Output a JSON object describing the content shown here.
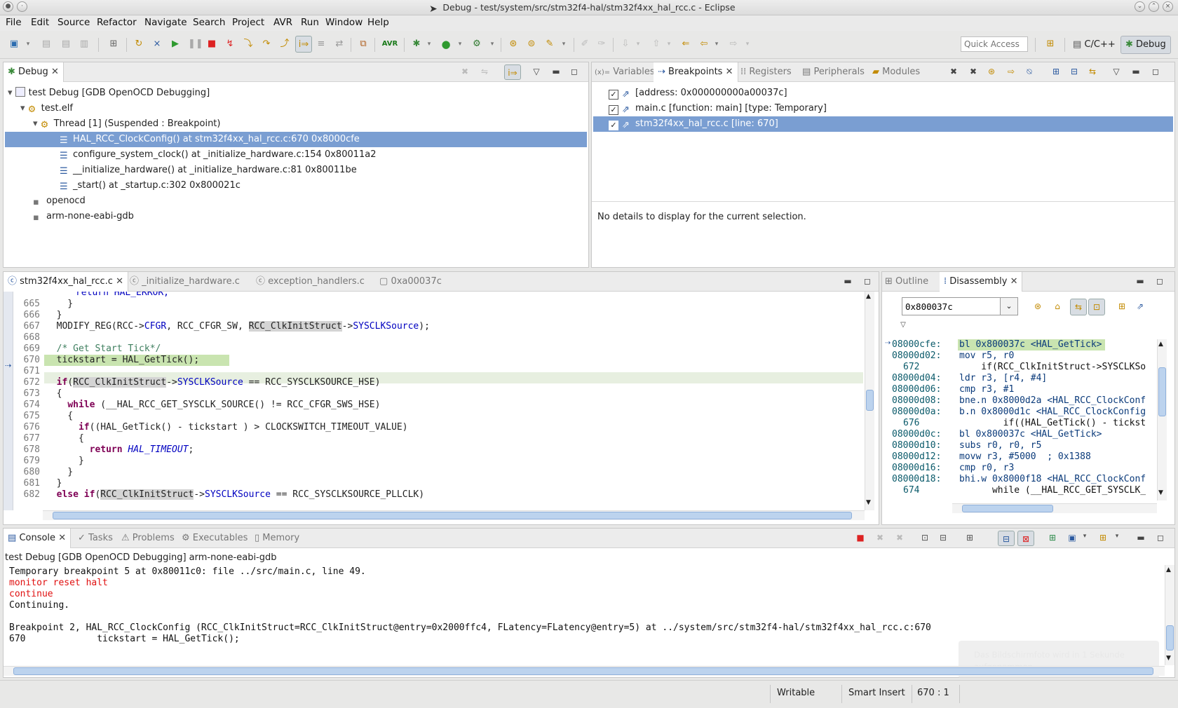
{
  "window": {
    "title": "Debug - test/system/src/stm32f4-hal/stm32f4xx_hal_rcc.c - Eclipse"
  },
  "menu": [
    "File",
    "Edit",
    "Source",
    "Refactor",
    "Navigate",
    "Search",
    "Project",
    "AVR",
    "Run",
    "Window",
    "Help"
  ],
  "toolbar": {
    "quick_access_placeholder": "Quick Access",
    "perspective_cpp": "C/C++",
    "perspective_debug": "Debug",
    "avr_label": "AVR"
  },
  "debug_view": {
    "tab": "Debug",
    "launch": "test Debug [GDB OpenOCD Debugging]",
    "elf": "test.elf",
    "thread": "Thread [1] (Suspended : Breakpoint)",
    "frames": [
      "HAL_RCC_ClockConfig() at stm32f4xx_hal_rcc.c:670 0x8000cfe",
      "configure_system_clock() at _initialize_hardware.c:154 0x80011a2",
      "__initialize_hardware() at _initialize_hardware.c:81 0x80011be",
      "_start() at _startup.c:302 0x800021c"
    ],
    "processes": [
      "openocd",
      "arm-none-eabi-gdb"
    ]
  },
  "right_top": {
    "tabs": [
      "Variables",
      "Breakpoints",
      "Registers",
      "Peripherals",
      "Modules"
    ],
    "breakpoints": [
      "[address: 0x000000000a00037c]",
      "main.c [function: main] [type: Temporary]",
      "stm32f4xx_hal_rcc.c [line: 670]"
    ],
    "details": "No details to display for the current selection."
  },
  "editor": {
    "tabs": [
      "stm32f4xx_hal_rcc.c",
      "_initialize_hardware.c",
      "exception_handlers.c",
      "0xa00037c"
    ],
    "line_numbers": [
      "665",
      "666",
      "667",
      "668",
      "669",
      "670",
      "671",
      "672",
      "673",
      "674",
      "675",
      "676",
      "677",
      "678",
      "679",
      "680",
      "681",
      "682"
    ],
    "partial_top": "      return HAL_ERROR;",
    "l665": "    }",
    "l666": "  }",
    "l667a": "  MODIFY_REG(RCC->",
    "l667b": "CFGR",
    "l667c": ", RCC_CFGR_SW, ",
    "l667d": "RCC_ClkInitStruct",
    "l667e": "->",
    "l667f": "SYSCLKSource",
    "l667g": ");",
    "l669": "  /* Get Start Tick*/",
    "l670": "  tickstart = HAL_GetTick();",
    "l672a": "if",
    "l672b": "(",
    "l672c": "RCC_ClkInitStruct",
    "l672d": "->",
    "l672e": "SYSCLKSource",
    "l672f": " == RCC_SYSCLKSOURCE_HSE)",
    "l673": "  {",
    "l674a": "while",
    "l674b": " (__HAL_RCC_GET_SYSCLK_SOURCE() != RCC_CFGR_SWS_HSE)",
    "l675": "    {",
    "l676a": "if",
    "l676b": "((HAL_GetTick() - tickstart ) > CLOCKSWITCH_TIMEOUT_VALUE)",
    "l677": "      {",
    "l678a": "return",
    "l678b": "HAL_TIMEOUT",
    "l678c": ";",
    "l679": "      }",
    "l680": "    }",
    "l681": "  }",
    "l682a": "else if",
    "l682b": "(",
    "l682c": "RCC_ClkInitStruct",
    "l682d": "->",
    "l682e": "SYSCLKSource",
    "l682f": " == RCC_SYSCLKSOURCE_PLLCLK)"
  },
  "disasm": {
    "tabs": [
      "Outline",
      "Disassembly"
    ],
    "address_input": "0x800037c",
    "lines": [
      {
        "addr": "08000cfe:",
        "text": "bl 0x800037c <HAL_GetTick>"
      },
      {
        "addr": "08000d02:",
        "text": "mov r5, r0"
      },
      {
        "addr": "672",
        "text": "    if(RCC_ClkInitStruct->SYSCLKSo"
      },
      {
        "addr": "08000d04:",
        "text": "ldr r3, [r4, #4]"
      },
      {
        "addr": "08000d06:",
        "text": "cmp r3, #1"
      },
      {
        "addr": "08000d08:",
        "text": "bne.n 0x8000d2a <HAL_RCC_ClockConf"
      },
      {
        "addr": "08000d0a:",
        "text": "b.n 0x8000d1c <HAL_RCC_ClockConfig"
      },
      {
        "addr": "676",
        "text": "        if((HAL_GetTick() - tickst"
      },
      {
        "addr": "08000d0c:",
        "text": "bl 0x800037c <HAL_GetTick>"
      },
      {
        "addr": "08000d10:",
        "text": "subs r0, r0, r5"
      },
      {
        "addr": "08000d12:",
        "text": "movw r3, #5000  ; 0x1388"
      },
      {
        "addr": "08000d16:",
        "text": "cmp r0, r3"
      },
      {
        "addr": "08000d18:",
        "text": "bhi.w 0x8000f18 <HAL_RCC_ClockConf"
      },
      {
        "addr": "674",
        "text": "      while (__HAL_RCC_GET_SYSCLK_"
      }
    ]
  },
  "console": {
    "tabs": [
      "Console",
      "Tasks",
      "Problems",
      "Executables",
      "Memory"
    ],
    "header": "test Debug [GDB OpenOCD Debugging] arm-none-eabi-gdb",
    "lines": [
      "Temporary breakpoint 5 at 0x80011c0: file ../src/main.c, line 49.",
      "monitor reset halt",
      "continue",
      "Continuing.",
      "",
      "Breakpoint 2, HAL_RCC_ClockConfig (RCC_ClkInitStruct=RCC_ClkInitStruct@entry=0x2000ffc4, FLatency=FLatency@entry=5) at ../system/src/stm32f4-hal/stm32f4xx_hal_rcc.c:670",
      "670\t\ttickstart = HAL_GetTick();"
    ],
    "colors": {
      "command": "#e01010",
      "normal": "#111111"
    },
    "toast": "Das Bildschirmfoto wird in 1 Sekunde aufgenommen"
  },
  "status": {
    "writable": "Writable",
    "insert": "Smart Insert",
    "position": "670 : 1"
  }
}
